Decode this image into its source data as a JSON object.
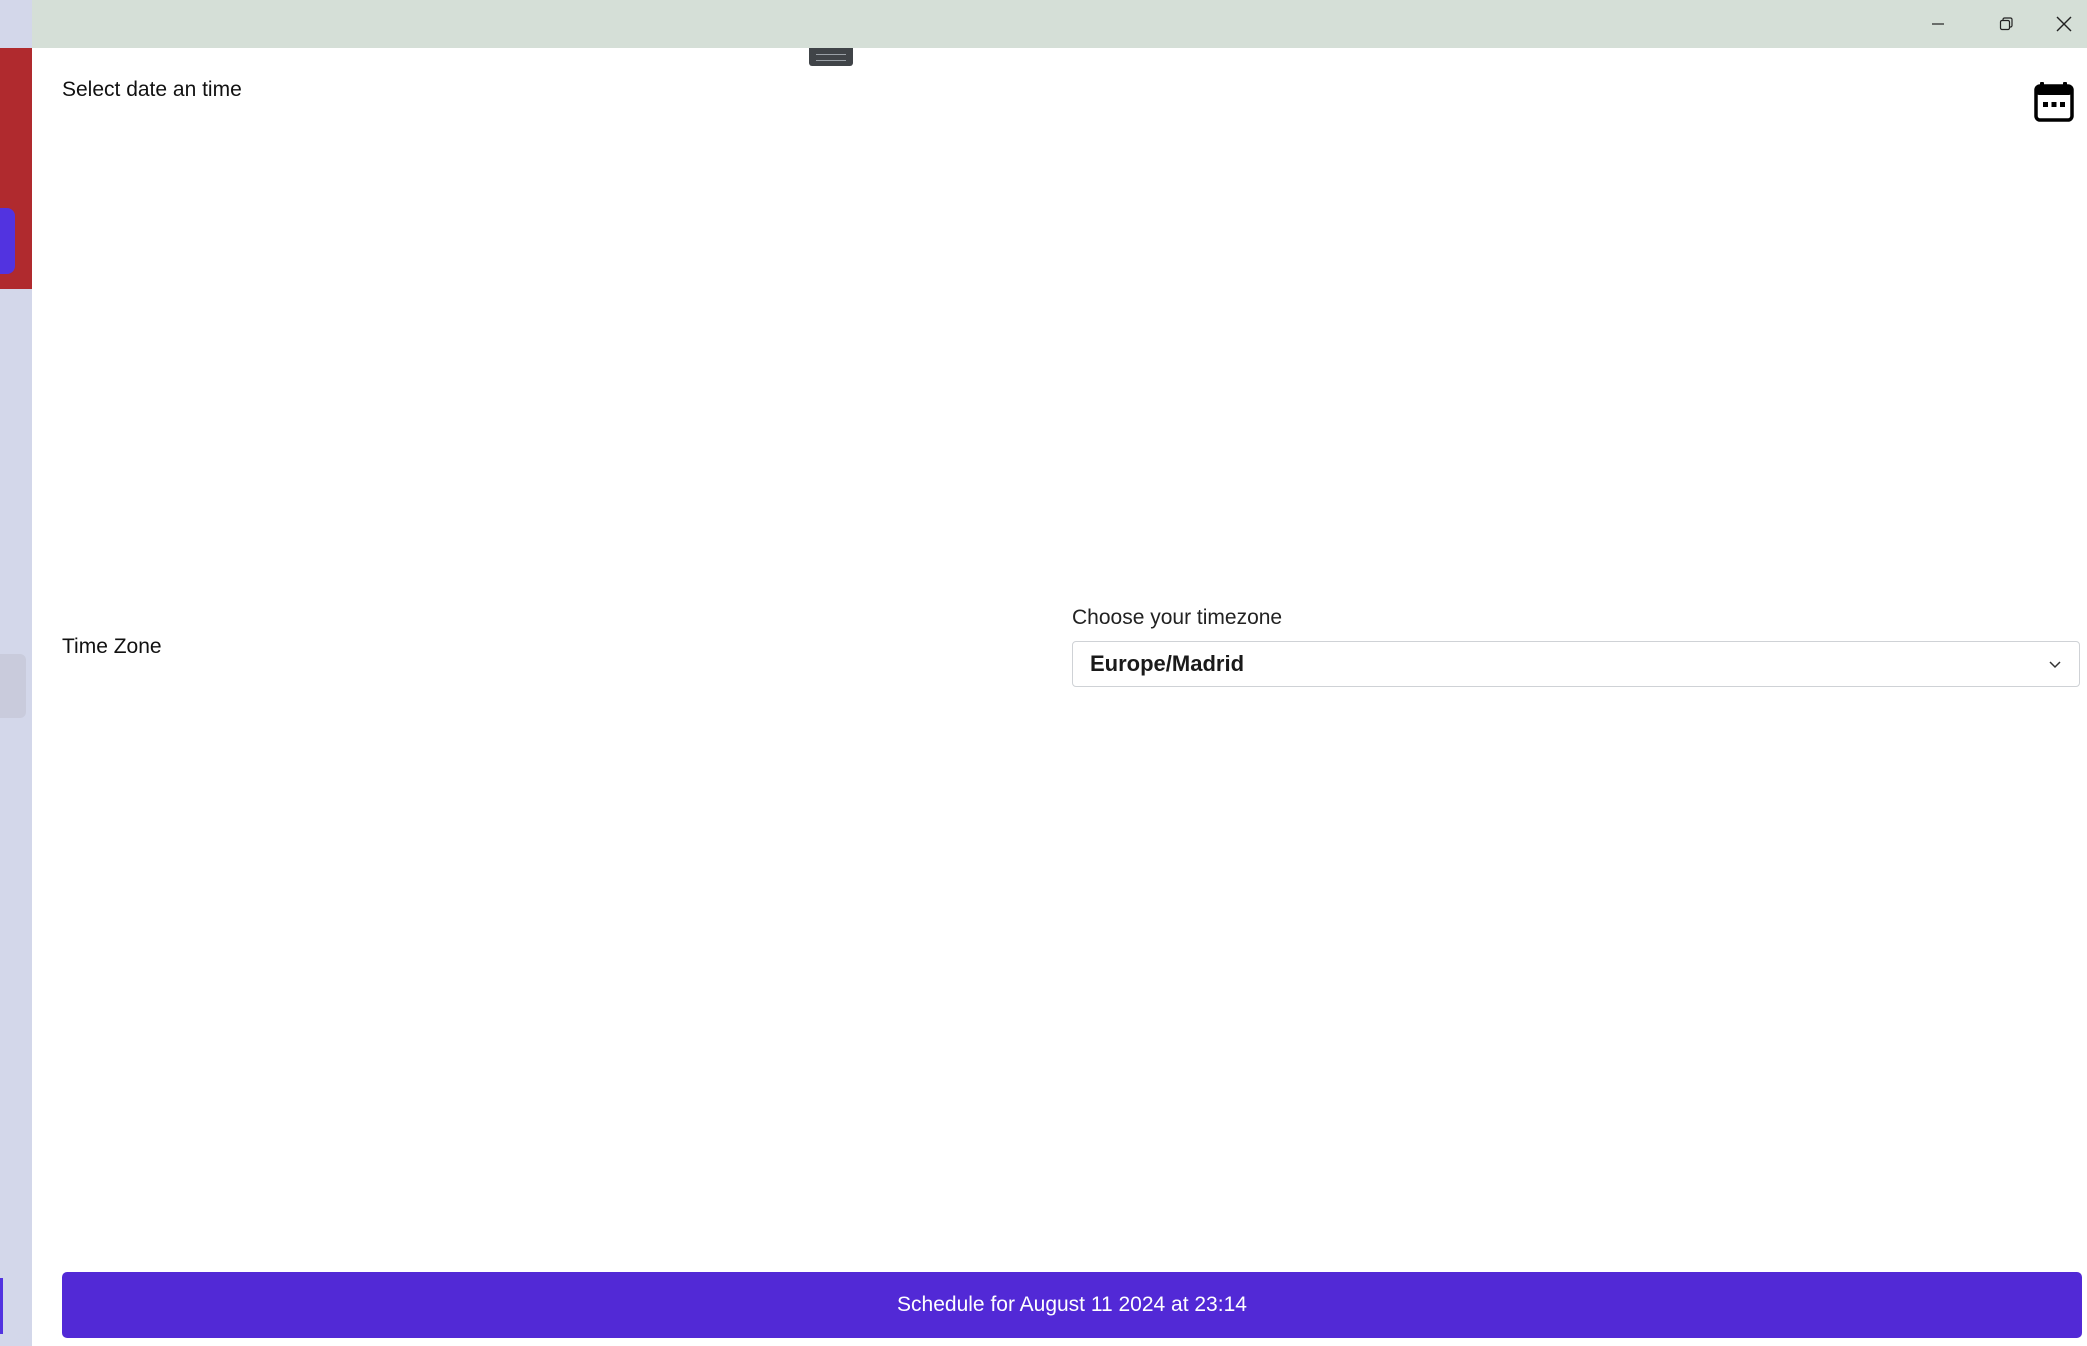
{
  "window": {
    "controls": {
      "minimize_icon": "minimize-icon",
      "maximize_icon": "restore-icon",
      "close_icon": "close-icon"
    }
  },
  "dialog": {
    "date_label": "Select date an time",
    "calendar_icon": "calendar-icon",
    "timezone": {
      "row_label": "Time Zone",
      "caption": "Choose your timezone",
      "selected": "Europe/Madrid",
      "chevron_icon": "chevron-down-icon"
    },
    "schedule_button_label": "Schedule for August 11 2024 at 23:14"
  },
  "colors": {
    "accent": "#5229d6",
    "titlebar": "#d5dfd7",
    "background_app_red": "#b02a2e",
    "background_app_strip": "#d3d7ea"
  }
}
